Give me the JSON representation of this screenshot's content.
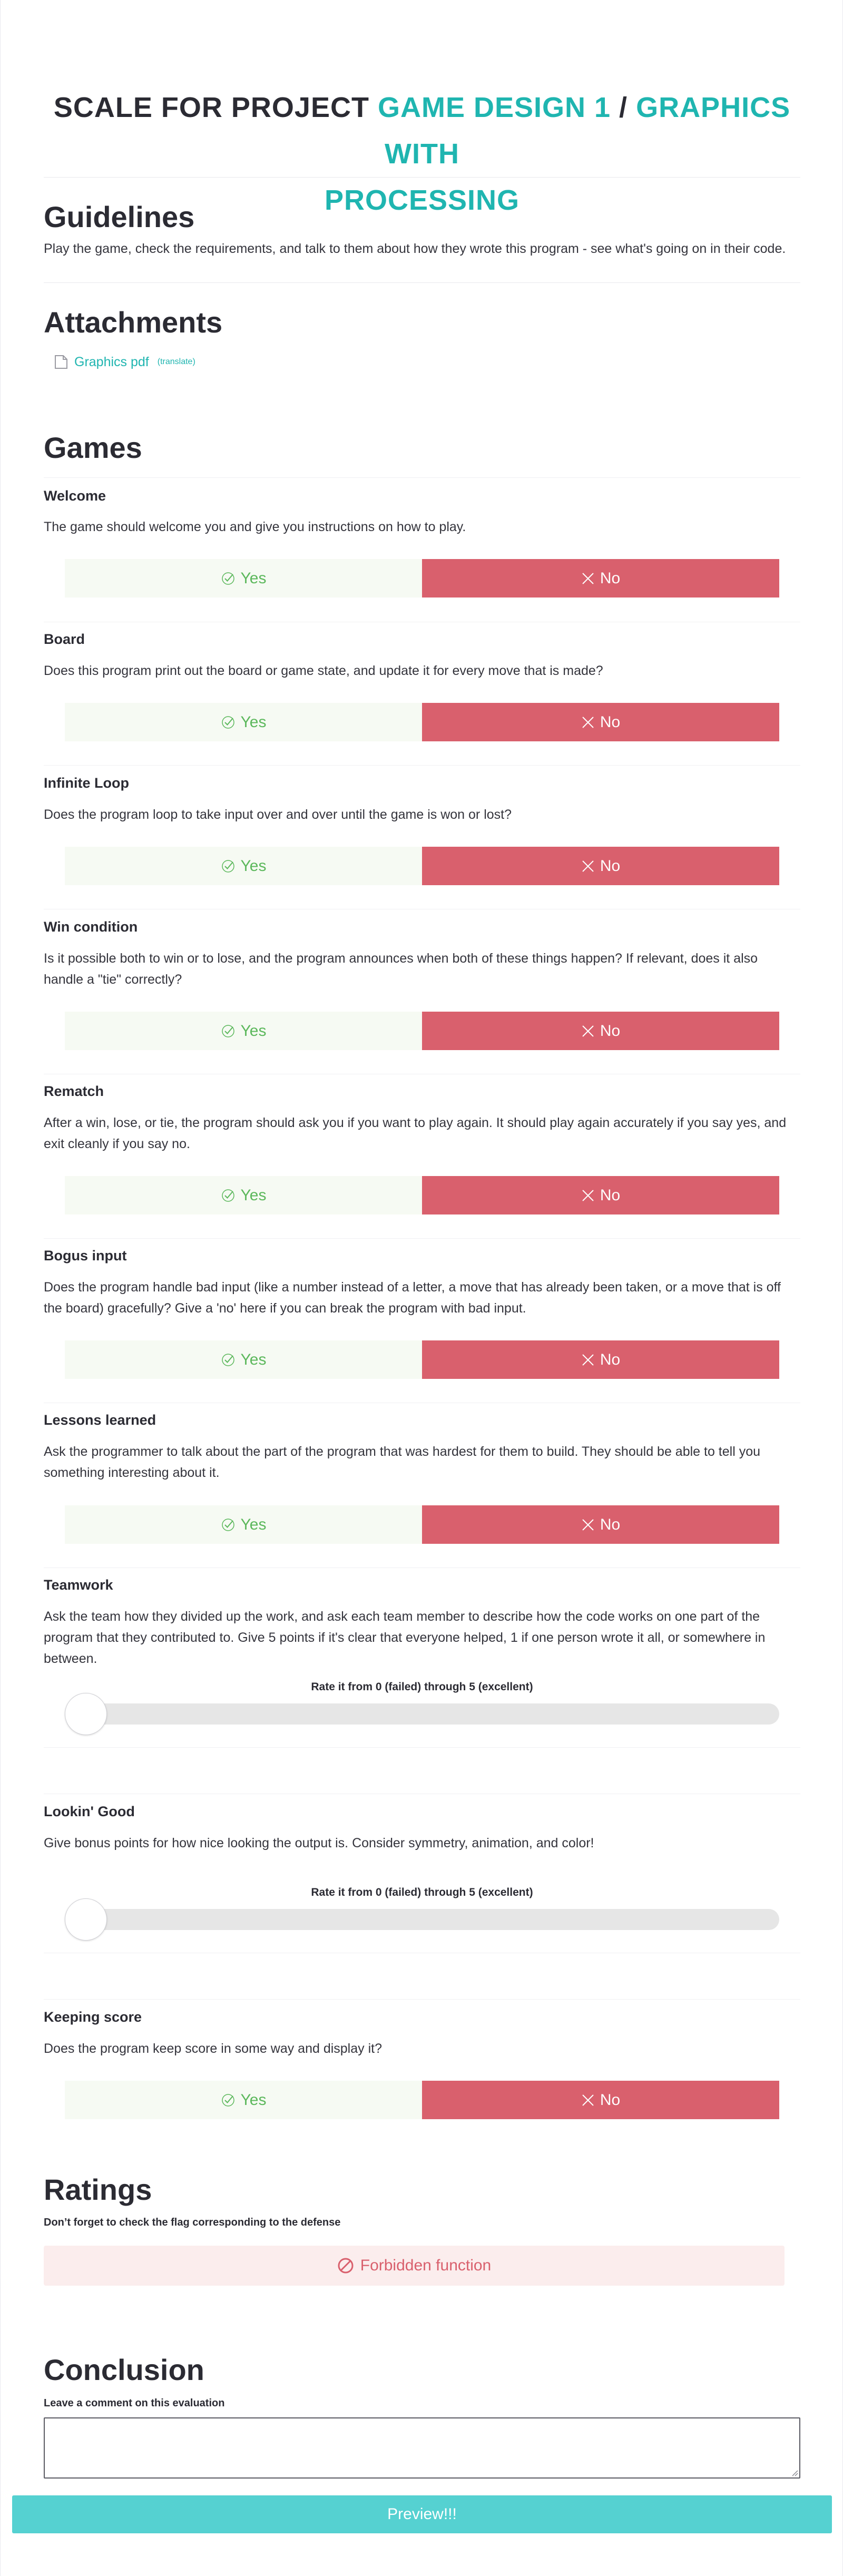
{
  "title": {
    "prefix": "SCALE FOR PROJECT ",
    "project_line1": "GAME DESIGN 1",
    "separator": " / ",
    "project_line2_a": "GRAPHICS WITH",
    "project_line2_b": "PROCESSING"
  },
  "guidelines": {
    "heading": "Guidelines",
    "text": "Play the game, check the requirements, and talk to them about how they wrote this program - see what's going on in their code."
  },
  "attachments": {
    "heading": "Attachments",
    "items": [
      {
        "name": "Graphics pdf",
        "extra": "(translate)",
        "icon": "document-icon"
      }
    ]
  },
  "games": {
    "heading": "Games",
    "yes_label": "Yes",
    "no_label": "No",
    "rate_label": "Rate it from 0 (failed) through 5 (excellent)",
    "slider_value": 0,
    "questions": [
      {
        "title": "Welcome",
        "text": "The game should welcome you and give you instructions on how to play."
      },
      {
        "title": "Board",
        "text": "Does this program print out the board or game state, and update it for every move that is made?"
      },
      {
        "title": "Infinite Loop",
        "text": "Does the program loop to take input over and over until the game is won or lost?"
      },
      {
        "title": "Win condition",
        "text": "Is it possible both to win or to lose, and the program announces when both of these things happen? If relevant, does it also handle a \"tie\" correctly?"
      },
      {
        "title": "Rematch",
        "text": "After a win, lose, or tie, the program should ask you if you want to play again. It should play again accurately if you say yes, and exit cleanly if you say no."
      },
      {
        "title": "Bogus input",
        "text": "Does the program handle bad input (like a number instead of a letter, a move that has already been taken, or a move that is off the board) gracefully? Give a 'no' here if you can break the program with bad input."
      },
      {
        "title": "Lessons learned",
        "text": "Ask the programmer to talk about the part of the program that was hardest for them to build. They should be able to tell you something interesting about it."
      },
      {
        "title": "Teamwork",
        "text": "Ask the team how they divided up the work, and ask each team member to describe how the code works on one part of the program that they contributed to. Give 5 points if it's clear that everyone helped, 1 if one person wrote it all, or somewhere in between."
      },
      {
        "title": "Lookin' Good",
        "text": "Give bonus points for how nice looking the output is. Consider symmetry, animation, and color!"
      },
      {
        "title": "Keeping score",
        "text": "Does the program keep score in some way and display it?"
      }
    ]
  },
  "ratings": {
    "heading": "Ratings",
    "subtext": "Don’t forget to check the flag corresponding to the defense",
    "flag_label": "Forbidden function",
    "flag_icon": "forbidden-icon"
  },
  "conclusion": {
    "heading": "Conclusion",
    "subtext": "Leave a comment on this evaluation",
    "comment_value": ""
  },
  "preview_button": "Preview!!!",
  "colors": {
    "accent": "#1fb5b0",
    "yes_green": "#5cb85c",
    "no_red": "#d9606d",
    "preview": "#55d1d1"
  }
}
